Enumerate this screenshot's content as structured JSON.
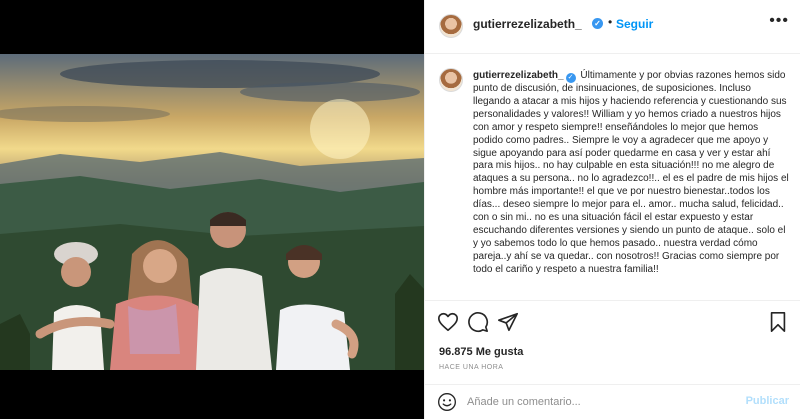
{
  "post": {
    "username": "gutierrezelizabeth_",
    "follow_label": "Seguir",
    "more_label": "•••",
    "separator": "•",
    "verified_mark": "✓",
    "caption": "Últimamente y por obvias razones hemos sido punto de discusión, de insinuaciones, de suposiciones. Incluso llegando a atacar a mis hijos y haciendo referencia y cuestionando sus personalidades y valores!! William y yo hemos criado a nuestros hijos con amor y respeto siempre!! enseñándoles lo mejor que hemos podido como padres.. Siempre le voy a agradecer que me apoyo y sigue apoyando para así poder quedarme en casa y ver y estar ahí para mis hijos.. no hay culpable en esta situación!!! no me alegro de ataques a su persona.. no lo agradezco!!.. el es el padre de mis hijos el hombre más importante!! el que ve por nuestro bienestar..todos los días... deseo siempre lo mejor para el.. amor.. mucha salud, felicidad.. con o sin mi.. no es una situación fácil el estar expuesto y estar escuchando diferentes versiones y siendo un punto de ataque.. solo el y yo sabemos todo lo que hemos pasado.. nuestra verdad cómo pareja..y ahí se va quedar.. con nosotros!! Gracias como siempre por todo el cariño y respeto a nuestra familia!!",
    "likes": "96.875 Me gusta",
    "timestamp": "HACE UNA HORA",
    "comment_placeholder": "Añade un comentario...",
    "publish_label": "Publicar"
  },
  "icons": {
    "like": "heart-icon",
    "comment": "comment-icon",
    "share": "share-icon",
    "save": "bookmark-icon",
    "emoji": "emoji-icon",
    "verified": "verified-badge-icon"
  },
  "colors": {
    "link_blue": "#0095f6",
    "verified_blue": "#3897f0",
    "publish_disabled": "#b2dffc",
    "muted": "#8e8e8e",
    "text": "#262626",
    "border": "#efefef"
  }
}
